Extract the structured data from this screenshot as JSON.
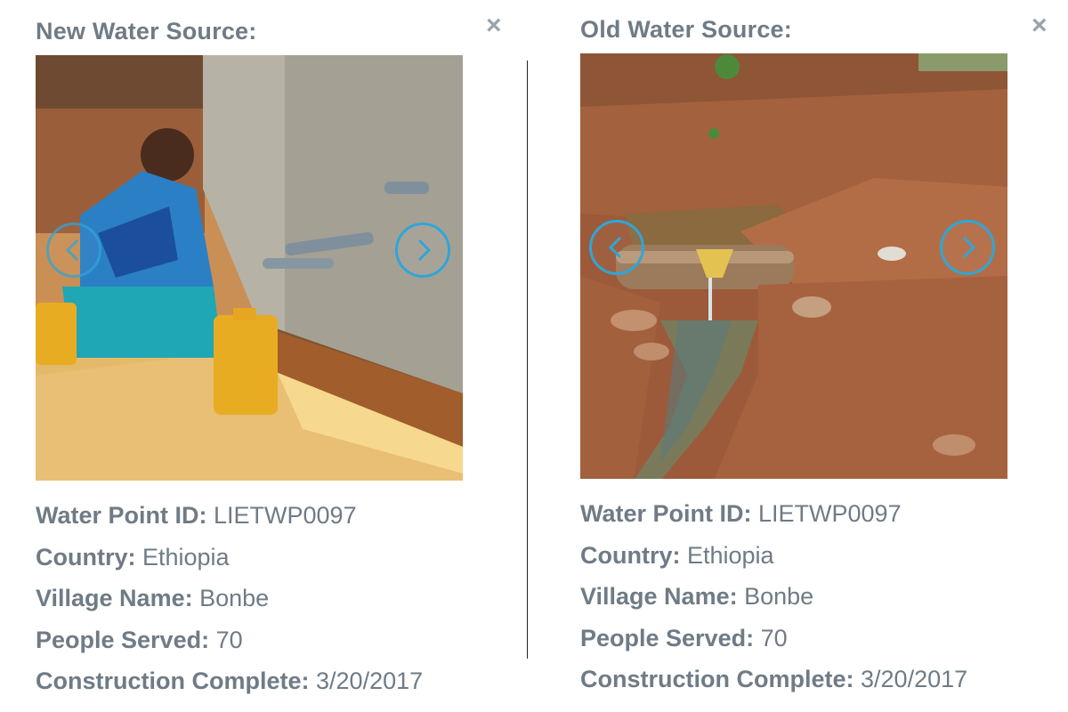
{
  "close_icon": "×",
  "accent_color": "#2ea6d8",
  "panels": {
    "new": {
      "title": "New Water Source:",
      "photo_icon": "photo-well-pump",
      "fields": [
        {
          "label": "Water Point ID:",
          "value": "LIETWP0097"
        },
        {
          "label": "Country:",
          "value": "Ethiopia"
        },
        {
          "label": "Village Name:",
          "value": "Bonbe"
        },
        {
          "label": "People Served:",
          "value": "70"
        },
        {
          "label": "Construction Complete:",
          "value": "3/20/2017"
        }
      ]
    },
    "old": {
      "title": "Old Water Source:",
      "photo_icon": "photo-open-spring",
      "fields": [
        {
          "label": "Water Point ID:",
          "value": "LIETWP0097"
        },
        {
          "label": "Country:",
          "value": "Ethiopia"
        },
        {
          "label": "Village Name:",
          "value": "Bonbe"
        },
        {
          "label": "People Served:",
          "value": "70"
        },
        {
          "label": "Construction Complete:",
          "value": "3/20/2017"
        }
      ]
    }
  }
}
